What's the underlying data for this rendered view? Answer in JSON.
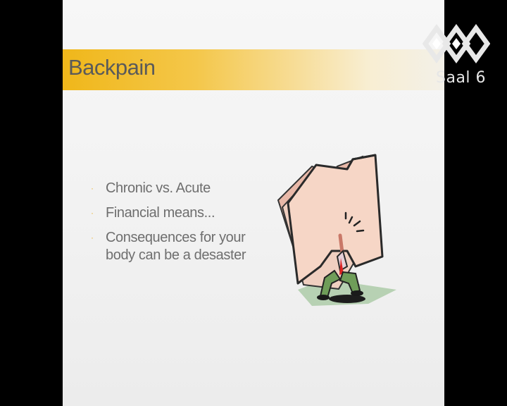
{
  "slide": {
    "title": "Backpain",
    "bullets": [
      {
        "text": "Chronic vs. Acute"
      },
      {
        "text": "Financial means..."
      },
      {
        "text": "Consequences for your body can be a desaster"
      }
    ],
    "bullet_glyph": "·",
    "illustration": "man-carrying-giant-folder-clipart"
  },
  "overlay": {
    "channel_label": "Saal 6",
    "logo_icon": "ccc-diamond-logo-icon"
  },
  "colors": {
    "title_bar_accent": "#f0b71a",
    "bullet_accent": "#e9b53a",
    "text": "#6e6e6e",
    "background": "#000000"
  }
}
